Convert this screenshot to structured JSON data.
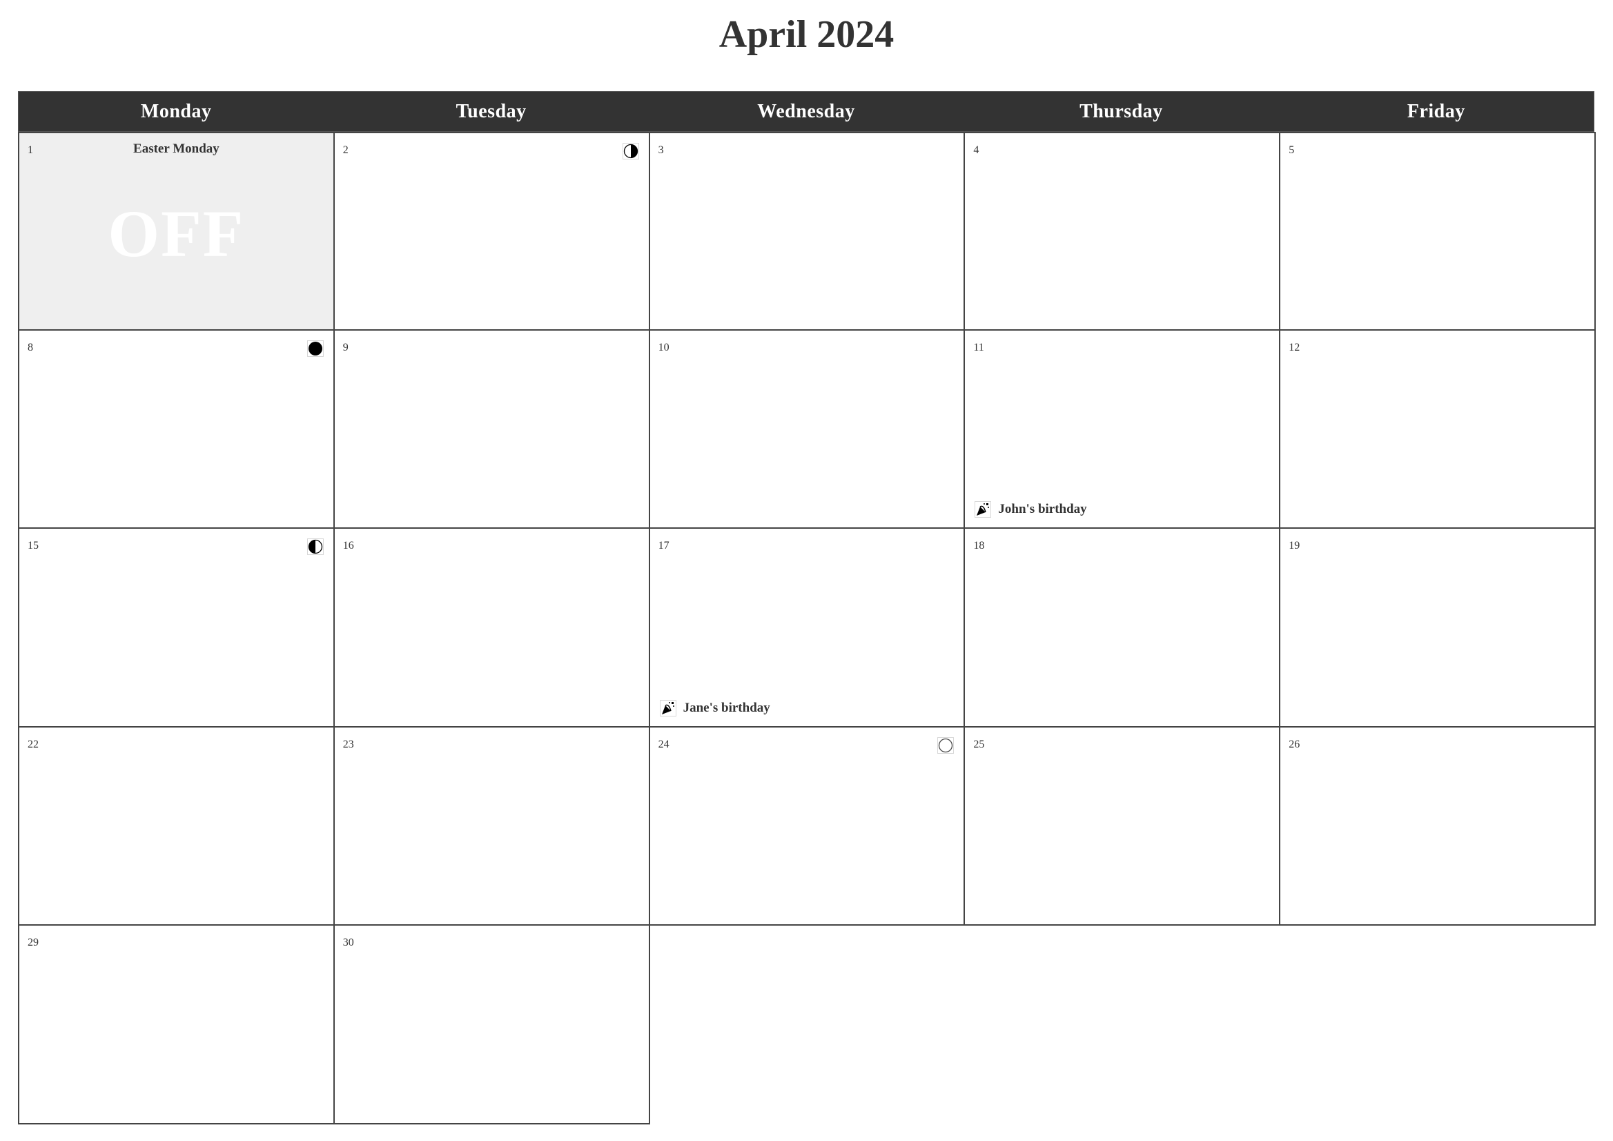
{
  "title": "April 2024",
  "weekdays": [
    "Monday",
    "Tuesday",
    "Wednesday",
    "Thursday",
    "Friday"
  ],
  "days": [
    {
      "day": "1",
      "holiday": "Easter Monday",
      "off": true,
      "off_label": "OFF"
    },
    {
      "day": "2",
      "moon": "first-quarter"
    },
    {
      "day": "3"
    },
    {
      "day": "4"
    },
    {
      "day": "5"
    },
    {
      "day": "8",
      "moon": "new-moon"
    },
    {
      "day": "9"
    },
    {
      "day": "10"
    },
    {
      "day": "11",
      "event": {
        "label": "John's birthday",
        "icon": "party-popper"
      }
    },
    {
      "day": "12"
    },
    {
      "day": "15",
      "moon": "last-quarter"
    },
    {
      "day": "16"
    },
    {
      "day": "17",
      "event": {
        "label": "Jane's birthday",
        "icon": "party-popper"
      }
    },
    {
      "day": "18"
    },
    {
      "day": "19"
    },
    {
      "day": "22"
    },
    {
      "day": "23"
    },
    {
      "day": "24",
      "moon": "full-moon"
    },
    {
      "day": "25"
    },
    {
      "day": "26"
    },
    {
      "day": "29"
    },
    {
      "day": "30"
    }
  ]
}
